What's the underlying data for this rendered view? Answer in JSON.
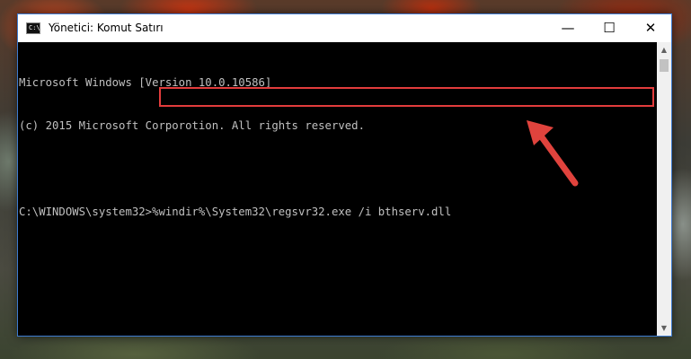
{
  "window": {
    "title": "Yönetici: Komut Satırı",
    "icon_text": "C:\\",
    "buttons": {
      "minimize": "—",
      "maximize": "☐",
      "close": "✕"
    }
  },
  "console": {
    "lines": [
      "Microsoft Windows [Version 10.0.10586]",
      "(c) 2015 Microsoft Corporotion. All rights reserved.",
      "",
      "C:\\WINDOWS\\system32>%windir%\\System32\\regsvr32.exe /i bthserv.dll"
    ]
  },
  "scrollbar": {
    "up": "▲",
    "down": "▼"
  },
  "colors": {
    "highlight": "#e23c3c",
    "arrow": "#e0433d",
    "console_bg": "#000000",
    "console_text": "#c0c0c0"
  }
}
